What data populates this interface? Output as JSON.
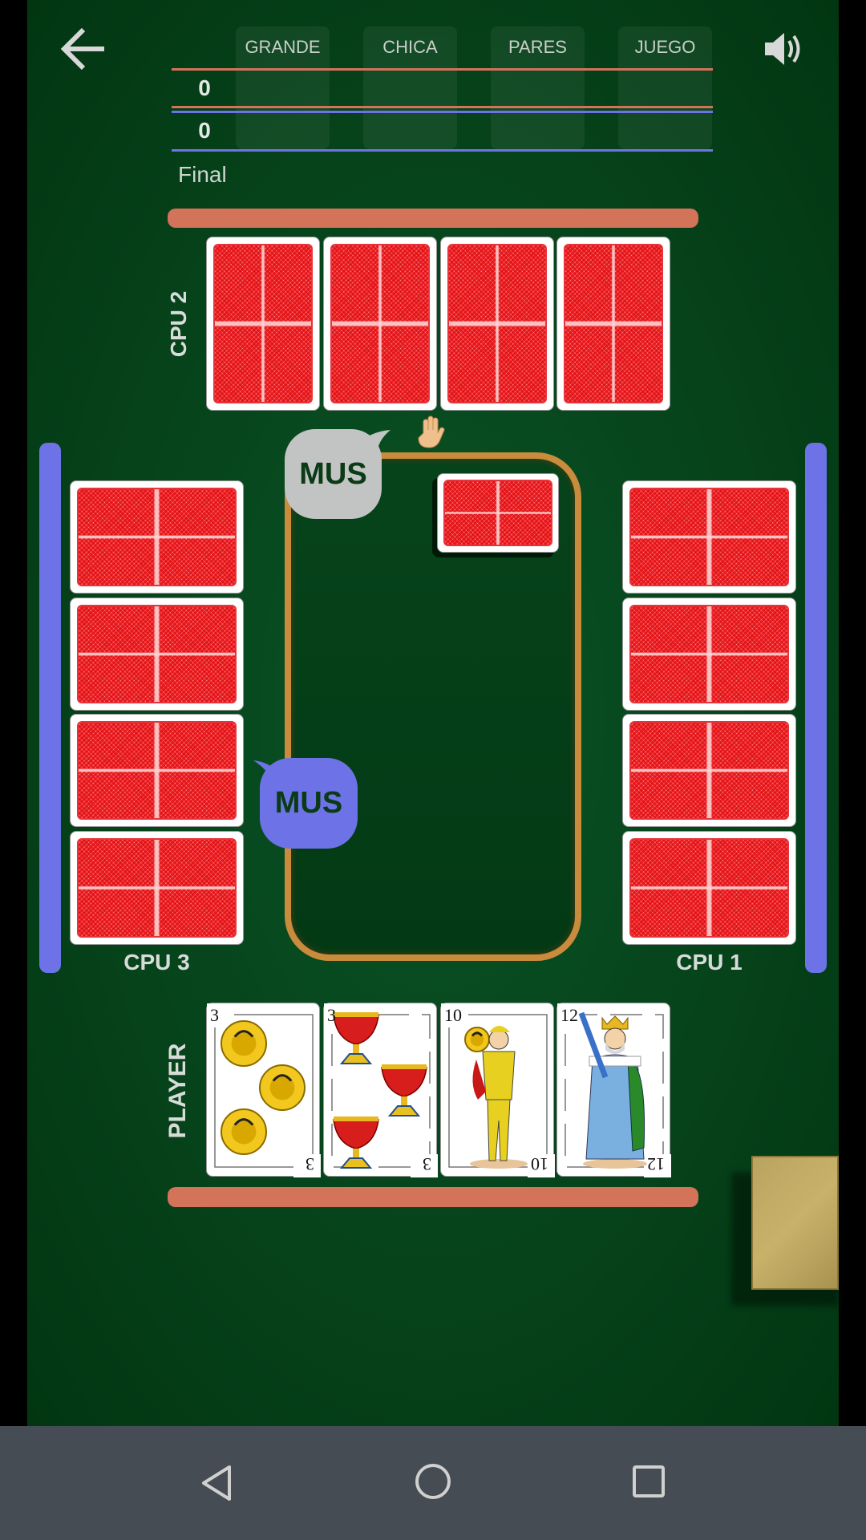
{
  "header": {
    "back_icon": "arrow-left-icon",
    "sound_icon": "speaker-icon"
  },
  "scoreboard": {
    "columns": [
      "GRANDE",
      "CHICA",
      "PARES",
      "JUEGO"
    ],
    "team1_score": "0",
    "team2_score": "0",
    "status": "Final",
    "team1_color": "#d2735a",
    "team2_color": "#6d73e6"
  },
  "players": {
    "top": "CPU 2",
    "left": "CPU 3",
    "right": "CPU 1",
    "bottom": "PLAYER"
  },
  "bubbles": {
    "cpu2": "MUS",
    "cpu3": "MUS"
  },
  "player_hand": [
    {
      "rank": "3",
      "suit": "oros"
    },
    {
      "rank": "3",
      "suit": "copas"
    },
    {
      "rank": "10",
      "suit": "oros"
    },
    {
      "rank": "12",
      "suit": "espadas"
    }
  ],
  "indicator_icon": "raised-hand-icon",
  "nav": {
    "back": "nav-back-icon",
    "home": "nav-home-icon",
    "recents": "nav-recents-icon"
  }
}
